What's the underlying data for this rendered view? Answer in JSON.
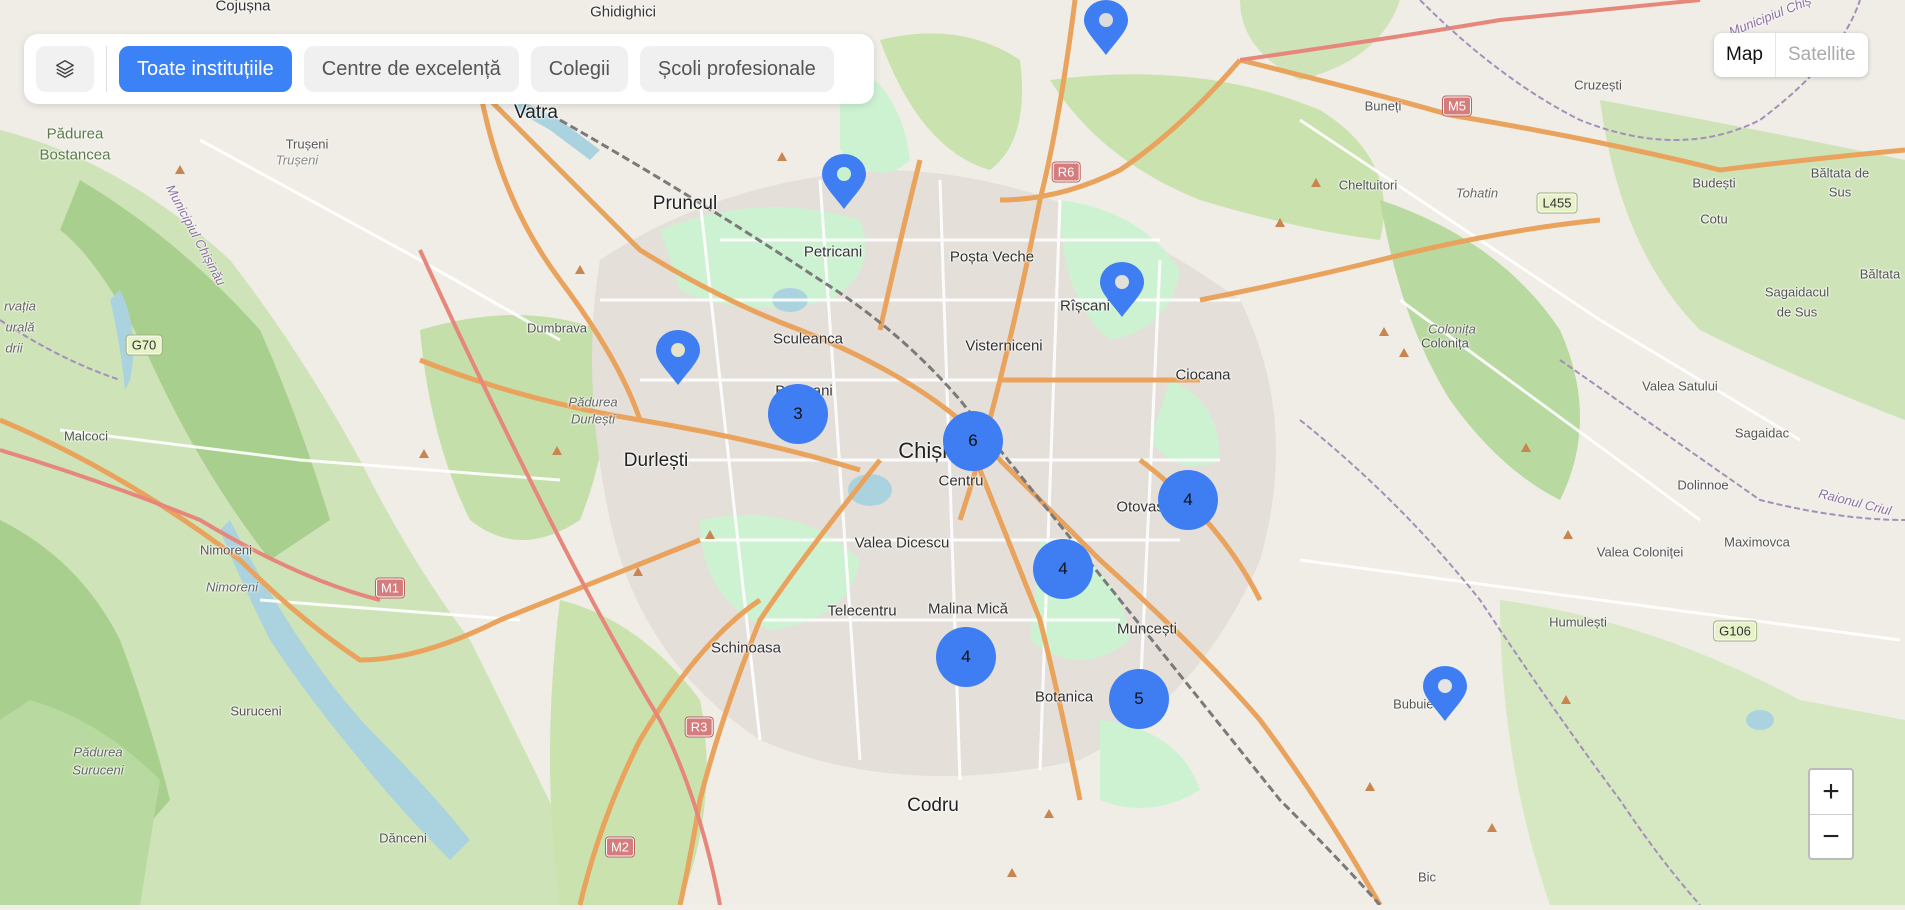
{
  "toolbar": {
    "layers_icon": "layers-icon",
    "filters": [
      {
        "label": "Toate instituțiile",
        "active": true
      },
      {
        "label": "Centre de excelență",
        "active": false
      },
      {
        "label": "Colegii",
        "active": false
      },
      {
        "label": "Școli profesionale",
        "active": false
      }
    ]
  },
  "map_type": {
    "map": "Map",
    "satellite": "Satellite",
    "selected": "Map"
  },
  "zoom": {
    "in": "+",
    "out": "−"
  },
  "clusters": [
    {
      "count": "3"
    },
    {
      "count": "6"
    },
    {
      "count": "4"
    },
    {
      "count": "4"
    },
    {
      "count": "4"
    },
    {
      "count": "5"
    }
  ],
  "places": {
    "cojusna": "Cojușna",
    "ghidighici": "Ghidighici",
    "vatra": "Vatra",
    "trusenii": "Trușeni",
    "padurea_bostancea": "Pădurea",
    "padurea_bostancea2": "Bostancea",
    "pruncul": "Pruncul",
    "petricani": "Petricani",
    "posta_veche": "Poșta Veche",
    "buneti": "Buneți",
    "cruzesti": "Cruzești",
    "budesti": "Budești",
    "cotu": "Cotu",
    "baltata_de_sus": "Băltata de",
    "baltata_de_sus2": "Sus",
    "cheltuitori": "Cheltuitori",
    "tohatin": "Tohatin",
    "dumbrava": "Dumbrava",
    "sculeanca": "Sculeanca",
    "visterniceni": "Visterniceni",
    "riscani": "Rîșcani",
    "ciocana": "Ciocana",
    "colonita": "Colonița",
    "colonita_it": "Colonița",
    "sagaidacul": "Sagaidacul",
    "sagaidacul2": "de Sus",
    "baltata": "Băltata",
    "valea_satului": "Valea Satului",
    "sagaidac": "Sagaidac",
    "malcoci": "Malcoci",
    "durlesti": "Durlești",
    "padurea_durlesti": "Pădurea",
    "padurea_durlesti2": "Durlești",
    "buiucani": "Buiucani",
    "chisinau": "Chișinău",
    "centru": "Centru",
    "otovasca": "Otovasca",
    "dolinnoe": "Dolinnoe",
    "valea_dicescu": "Valea Dicescu",
    "nimoreni": "Nimoreni",
    "nimoreni_it": "Nimoreni",
    "valea_colonitei": "Valea Coloniței",
    "maximovca": "Maximovca",
    "telecentru": "Telecentru",
    "malina_mica": "Malina Mică",
    "muncesti": "Muncești",
    "humulesti": "Humulești",
    "schinoasa": "Schinoasa",
    "botanica": "Botanica",
    "suruceni": "Suruceni",
    "padurea_suruceni": "Pădurea",
    "padurea_suruceni2": "Suruceni",
    "bubuieci": "Bubuieci",
    "codru": "Codru",
    "danceni": "Dănceni",
    "bic": "Bic",
    "municipiul_chisinau": "Municipiul Chișinău",
    "municipiul_chisinau_tr": "Municipiul Chiș",
    "raionul_criuleni": "Raionul Criul",
    "rezervatia": "rvația",
    "rezervatia2": "urală",
    "rezervatia3": "drii"
  },
  "roads": {
    "r6": "R6",
    "m5": "M5",
    "l455": "L455",
    "g70": "G70",
    "m1": "M1",
    "r3": "R3",
    "m2": "M2",
    "g106": "G106"
  },
  "colors": {
    "accent": "#3b82f6",
    "cluster": "#3f7ef2",
    "park": "#cdf2d2",
    "forest": "#a7cf8f",
    "water": "#aad3df",
    "land": "#f2efe9",
    "major_road": "#e9a35c",
    "highway": "#e7877b"
  }
}
